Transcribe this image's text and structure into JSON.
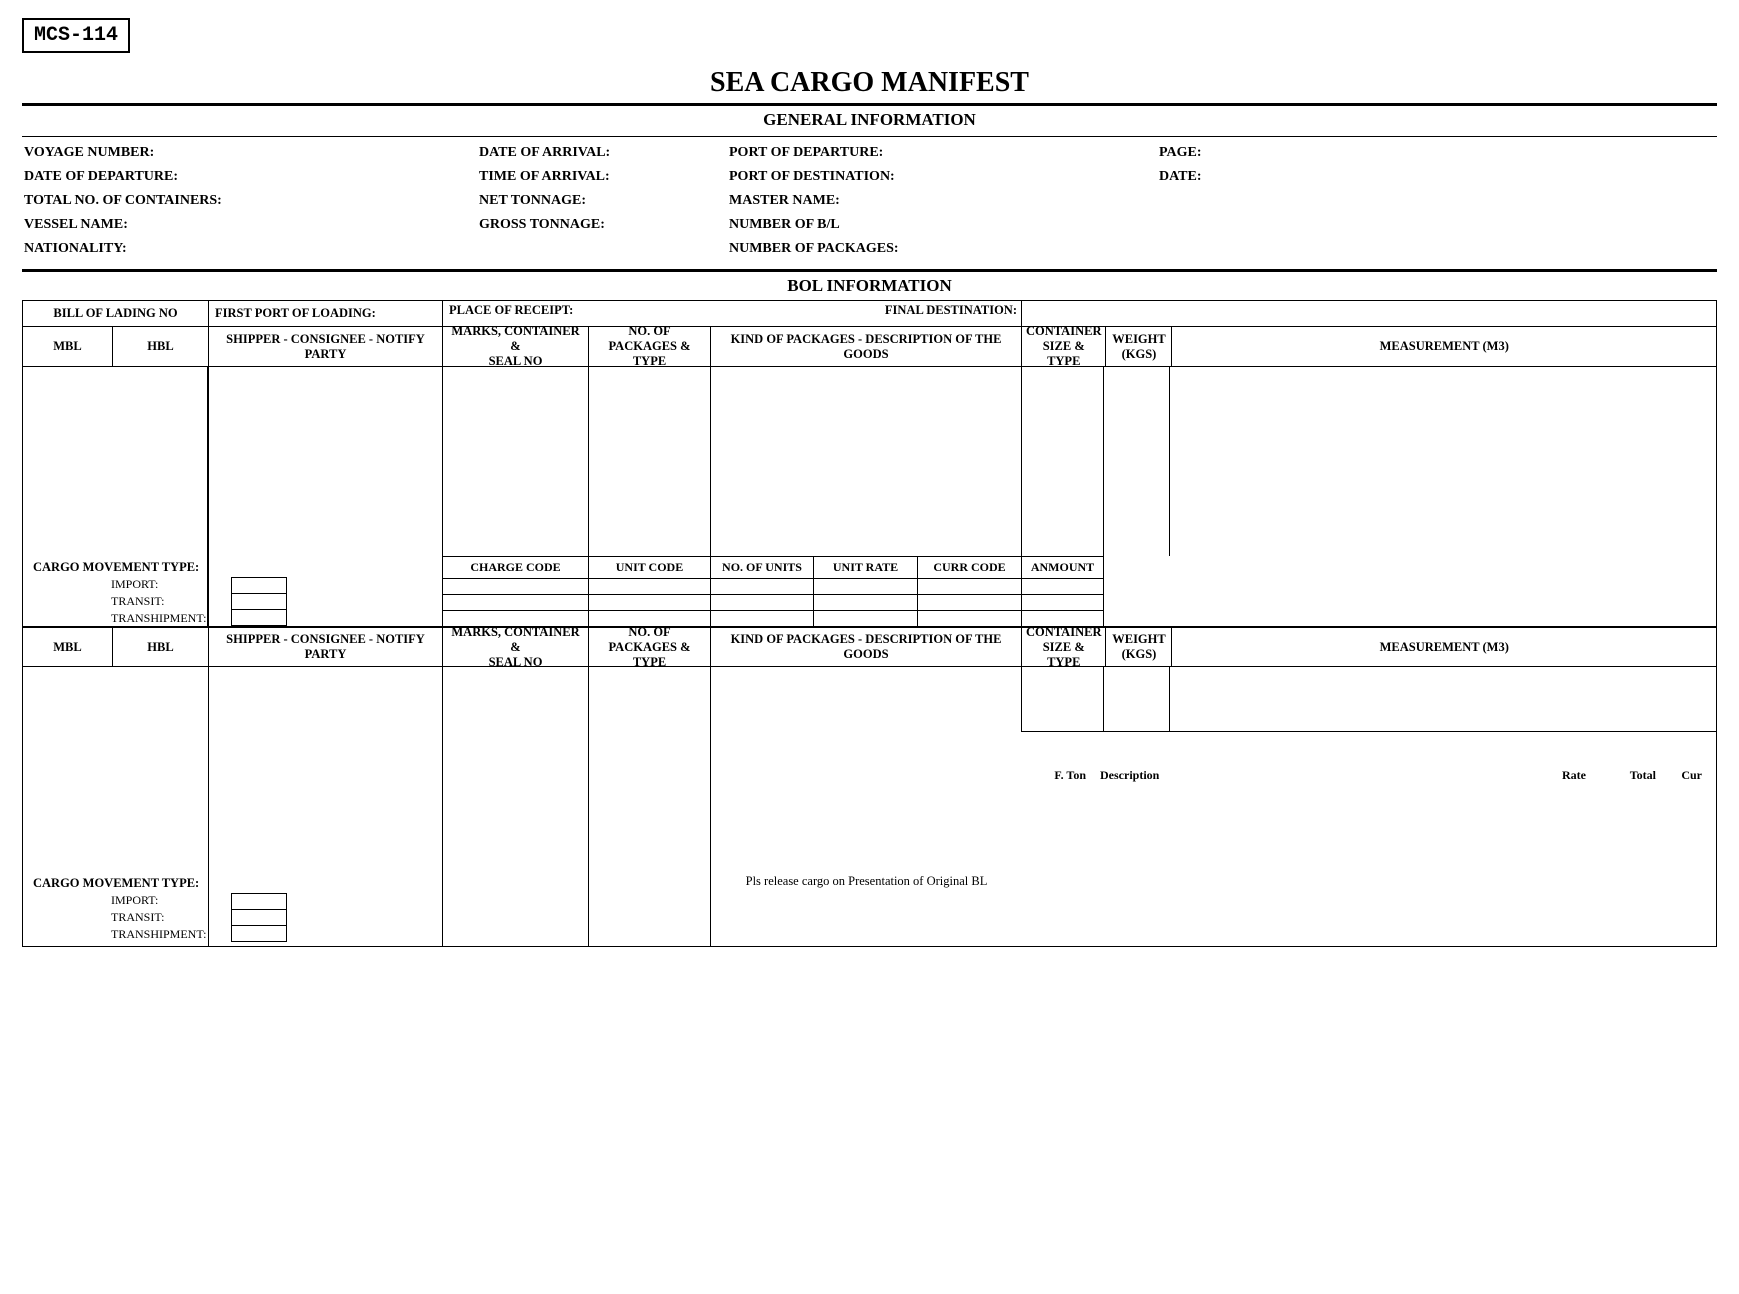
{
  "form_code": "MCS-114",
  "title": "SEA CARGO MANIFEST",
  "sections": {
    "general": "GENERAL INFORMATION",
    "bol": "BOL INFORMATION"
  },
  "general": {
    "col1": {
      "voyage_number": "VOYAGE NUMBER:",
      "date_departure": "DATE OF DEPARTURE:",
      "total_containers": "TOTAL NO. OF CONTAINERS:",
      "vessel_name": "VESSEL NAME:",
      "nationality": "NATIONALITY:"
    },
    "col2": {
      "date_arrival": "DATE OF ARRIVAL:",
      "time_arrival": "TIME OF ARRIVAL:",
      "net_tonnage": "NET TONNAGE:",
      "gross_tonnage": "GROSS TONNAGE:"
    },
    "col3": {
      "port_departure": "PORT OF DEPARTURE:",
      "port_destination": "PORT OF DESTINATION:",
      "master_name": "MASTER NAME:",
      "number_bl": "NUMBER OF B/L",
      "number_packages": "NUMBER OF PACKAGES:"
    },
    "col4": {
      "page": "PAGE:",
      "date": "DATE:"
    }
  },
  "bol_header": {
    "bill_of_lading": "BILL OF LADING NO",
    "first_port": "FIRST PORT OF LOADING:",
    "place_receipt": "PLACE OF RECEIPT:",
    "final_dest": "FINAL DESTINATION:",
    "mbl": "MBL",
    "hbl": "HBL",
    "shipper": "SHIPPER - CONSIGNEE - NOTIFY PARTY",
    "marks1": "MARKS, CONTAINER &",
    "marks2": "SEAL NO",
    "pkg1": "NO. OF PACKAGES &",
    "pkg2": "TYPE",
    "desc": "KIND OF PACKAGES - DESCRIPTION OF THE GOODS",
    "cont1": "CONTAINER",
    "cont2": "SIZE & TYPE",
    "wt1": "WEIGHT",
    "wt2": "(KGS)",
    "meas": "MEASUREMENT (M3)"
  },
  "cargo_movement": {
    "title": "CARGO MOVEMENT TYPE:",
    "import": "IMPORT:",
    "transit": "TRANSIT:",
    "transhipment": "TRANSHIPMENT:"
  },
  "charges": {
    "charge_code": "CHARGE CODE",
    "unit_code": "UNIT CODE",
    "no_units": "NO. OF UNITS",
    "unit_rate": "UNIT RATE",
    "curr_code": "CURR CODE",
    "amount": "ANMOUNT"
  },
  "body2": {
    "fton": "F. Ton",
    "desc": "Description",
    "rate": "Rate",
    "total": "Total",
    "cur": "Cur",
    "release_note": "Pls release cargo on Presentation of Original BL"
  }
}
